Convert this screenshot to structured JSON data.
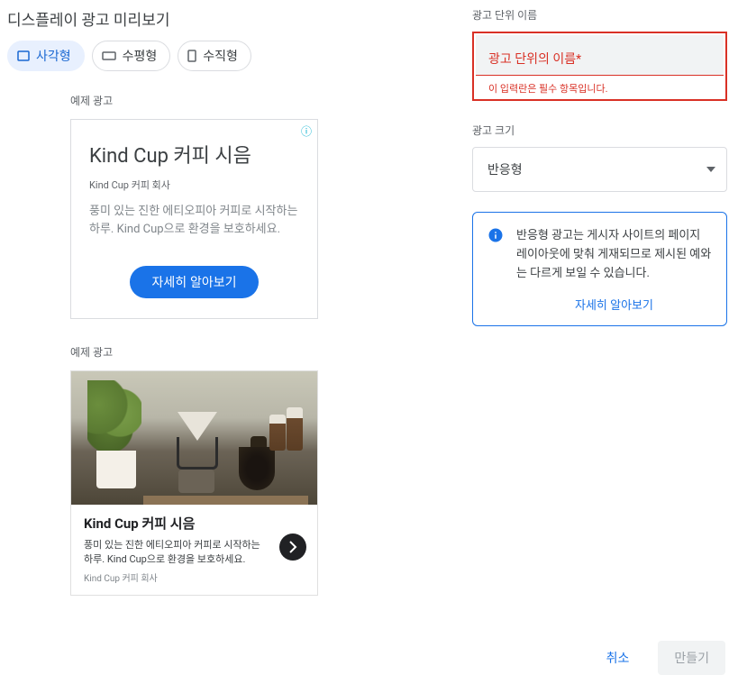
{
  "title": "디스플레이 광고 미리보기",
  "chips": {
    "square": "사각형",
    "horizontal": "수평형",
    "vertical": "수직형"
  },
  "sample_label": "예제 광고",
  "ad1": {
    "headline": "Kind Cup 커피 시음",
    "subtitle": "Kind Cup 커피 회사",
    "body": "풍미 있는 진한 에티오피아 커피로 시작하는 하루. Kind Cup으로 환경을 보호하세요.",
    "cta": "자세히 알아보기"
  },
  "ad2": {
    "headline": "Kind Cup 커피 시음",
    "body": "풍미 있는 진한 에티오피아 커피로 시작하는 하루. Kind Cup으로 환경을 보호하세요.",
    "subtitle": "Kind Cup 커피 회사"
  },
  "right": {
    "unit_name_section": "광고 단위 이름",
    "unit_name_placeholder": "광고 단위의 이름*",
    "unit_name_error": "이 입력란은 필수 항목입니다.",
    "size_section": "광고 크기",
    "size_value": "반응형",
    "info_text": "반응형 광고는 게시자 사이트의 페이지 레이아웃에 맞춰 게재되므로 제시된 예와는 다르게 보일 수 있습니다.",
    "info_link": "자세히 알아보기",
    "cancel": "취소",
    "create": "만들기"
  }
}
